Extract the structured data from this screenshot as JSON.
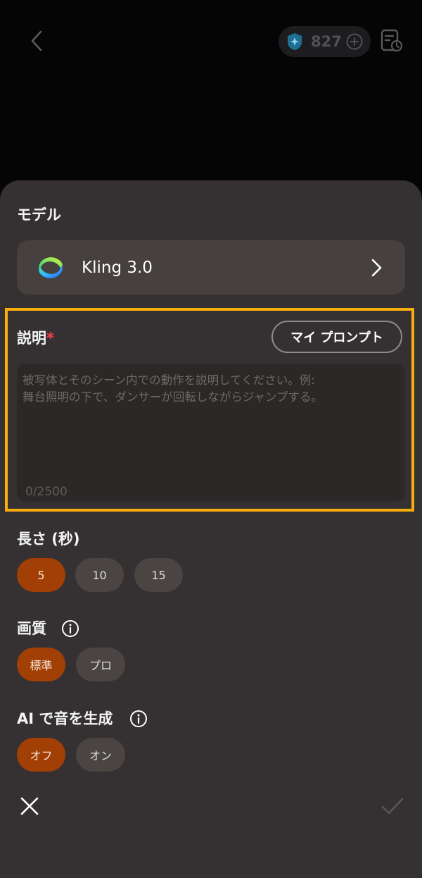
{
  "header": {
    "credits": "827"
  },
  "model": {
    "title": "モデル",
    "name": "Kling 3.0"
  },
  "description": {
    "label": "説明",
    "required_mark": "*",
    "my_prompt_button": "マイ プロンプト",
    "placeholder": "被写体とそのシーン内での動作を説明してください。例:\n舞台照明の下で、ダンサーが回転しながらジャンプする。",
    "char_count": "0/2500"
  },
  "length": {
    "title": "長さ (秒)",
    "options": [
      "5",
      "10",
      "15"
    ],
    "selected": "5"
  },
  "quality": {
    "title": "画質",
    "options": [
      "標準",
      "プロ"
    ],
    "selected": "標準"
  },
  "ai_audio": {
    "title": "AI で音を生成",
    "options": [
      "オフ",
      "オン"
    ],
    "selected": "オフ"
  },
  "colors": {
    "accent_selected": "#a13f05",
    "highlight_border": "#f7ad0a",
    "required": "#ff3b4a"
  }
}
